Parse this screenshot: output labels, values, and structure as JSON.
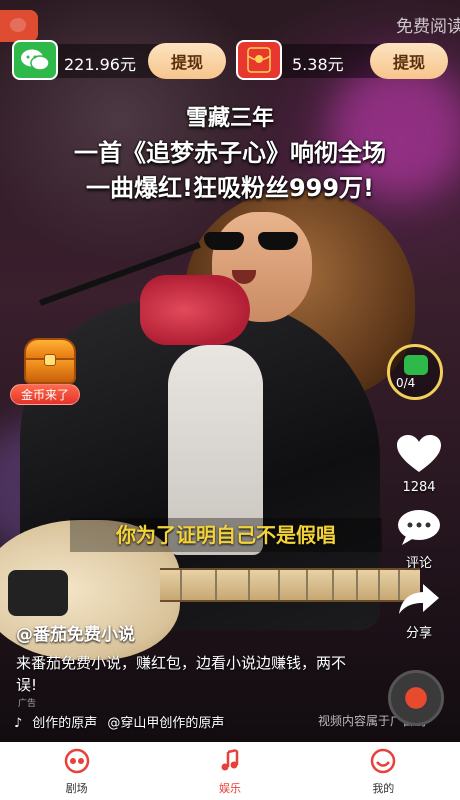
{
  "header": {
    "free_read": "免费阅读",
    "wechat_amount": "221.96元",
    "hongbao_amount": "5.38元",
    "withdraw_label": "提现",
    "withdraw_label_2": "提现"
  },
  "headline": {
    "line1": "雪藏三年",
    "line2": "一首《追梦赤子心》响彻全场",
    "line3": "一曲爆红!狂吸粉丝999万!"
  },
  "video_subtitle": "你为了证明自己不是假唱",
  "rewards": {
    "gold_label": "金币来了",
    "task_progress": "0/4"
  },
  "actions": {
    "likes": "1284",
    "comment": "评论",
    "share": "分享"
  },
  "info": {
    "author": "@番茄免费小说",
    "description": "来番茄免费小说，赚红包，边看小说边赚钱，两不误!",
    "ad_tag": "广告",
    "music_1": "创作的原声",
    "music_2": "@穿山甲创作的原声",
    "notice": "视频内容属于广告创"
  },
  "nav": {
    "items": [
      {
        "label": "剧场",
        "icon": "theater-icon"
      },
      {
        "label": "娱乐",
        "icon": "music-note-icon"
      },
      {
        "label": "我的",
        "icon": "profile-icon"
      }
    ],
    "active": "娱乐"
  },
  "colors": {
    "accent": "#e8403a",
    "wechat_green": "#2fb94a",
    "subtitle_yellow": "#f4d339"
  }
}
